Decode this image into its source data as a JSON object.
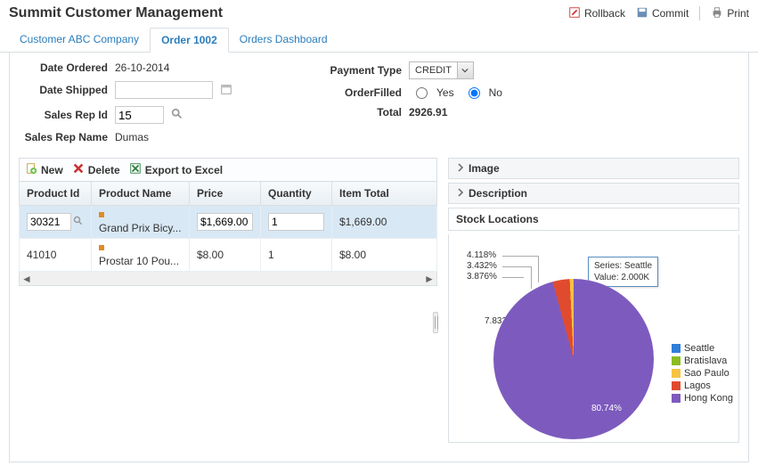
{
  "header": {
    "title": "Summit Customer Management",
    "rollback": "Rollback",
    "commit": "Commit",
    "print": "Print"
  },
  "tabs": [
    "Customer ABC Company",
    "Order 1002",
    "Orders Dashboard"
  ],
  "form": {
    "date_ordered_lbl": "Date Ordered",
    "date_ordered_val": "26-10-2014",
    "date_shipped_lbl": "Date Shipped",
    "date_shipped_val": "",
    "sales_rep_id_lbl": "Sales Rep Id",
    "sales_rep_id_val": "15",
    "sales_rep_name_lbl": "Sales Rep Name",
    "sales_rep_name_val": "Dumas",
    "payment_type_lbl": "Payment Type",
    "payment_type_val": "CREDIT",
    "order_filled_lbl": "OrderFilled",
    "yes": "Yes",
    "no": "No",
    "total_lbl": "Total",
    "total_val": "2926.91"
  },
  "toolbar": {
    "new": "New",
    "delete": "Delete",
    "export": "Export to Excel"
  },
  "grid": {
    "headers": [
      "Product Id",
      "Product Name",
      "Price",
      "Quantity",
      "Item Total"
    ],
    "rows": [
      {
        "id": "30321",
        "name": "Grand Prix Bicy...",
        "price": "$1,669.00",
        "qty": "1",
        "total": "$1,669.00"
      },
      {
        "id": "41010",
        "name": "Prostar 10 Pou...",
        "price": "$8.00",
        "qty": "1",
        "total": "$8.00"
      }
    ]
  },
  "right": {
    "image": "Image",
    "description": "Description",
    "stock_title": "Stock Locations",
    "tooltip_series": "Series: Seattle",
    "tooltip_value": "Value: 2.000K"
  },
  "chart_data": {
    "type": "pie",
    "title": "Stock Locations",
    "series": [
      {
        "name": "Seattle",
        "pct": 80.74,
        "value": 2000,
        "color": "#2f7ed8",
        "label": "80.74%"
      },
      {
        "name": "Bratislava",
        "pct": 7.832,
        "color": "#8bbc21",
        "label": "7.832%"
      },
      {
        "name": "Sao Paulo",
        "pct": 3.876,
        "color": "#f6c342",
        "label": "3.876%"
      },
      {
        "name": "Lagos",
        "pct": 3.432,
        "color": "#e04b30",
        "label": "3.432%"
      },
      {
        "name": "Hong Kong",
        "pct": 4.118,
        "color": "#7d5bbe",
        "label": "4.118%"
      }
    ],
    "legend": [
      "Seattle",
      "Bratislava",
      "Sao Paulo",
      "Lagos",
      "Hong Kong"
    ]
  }
}
